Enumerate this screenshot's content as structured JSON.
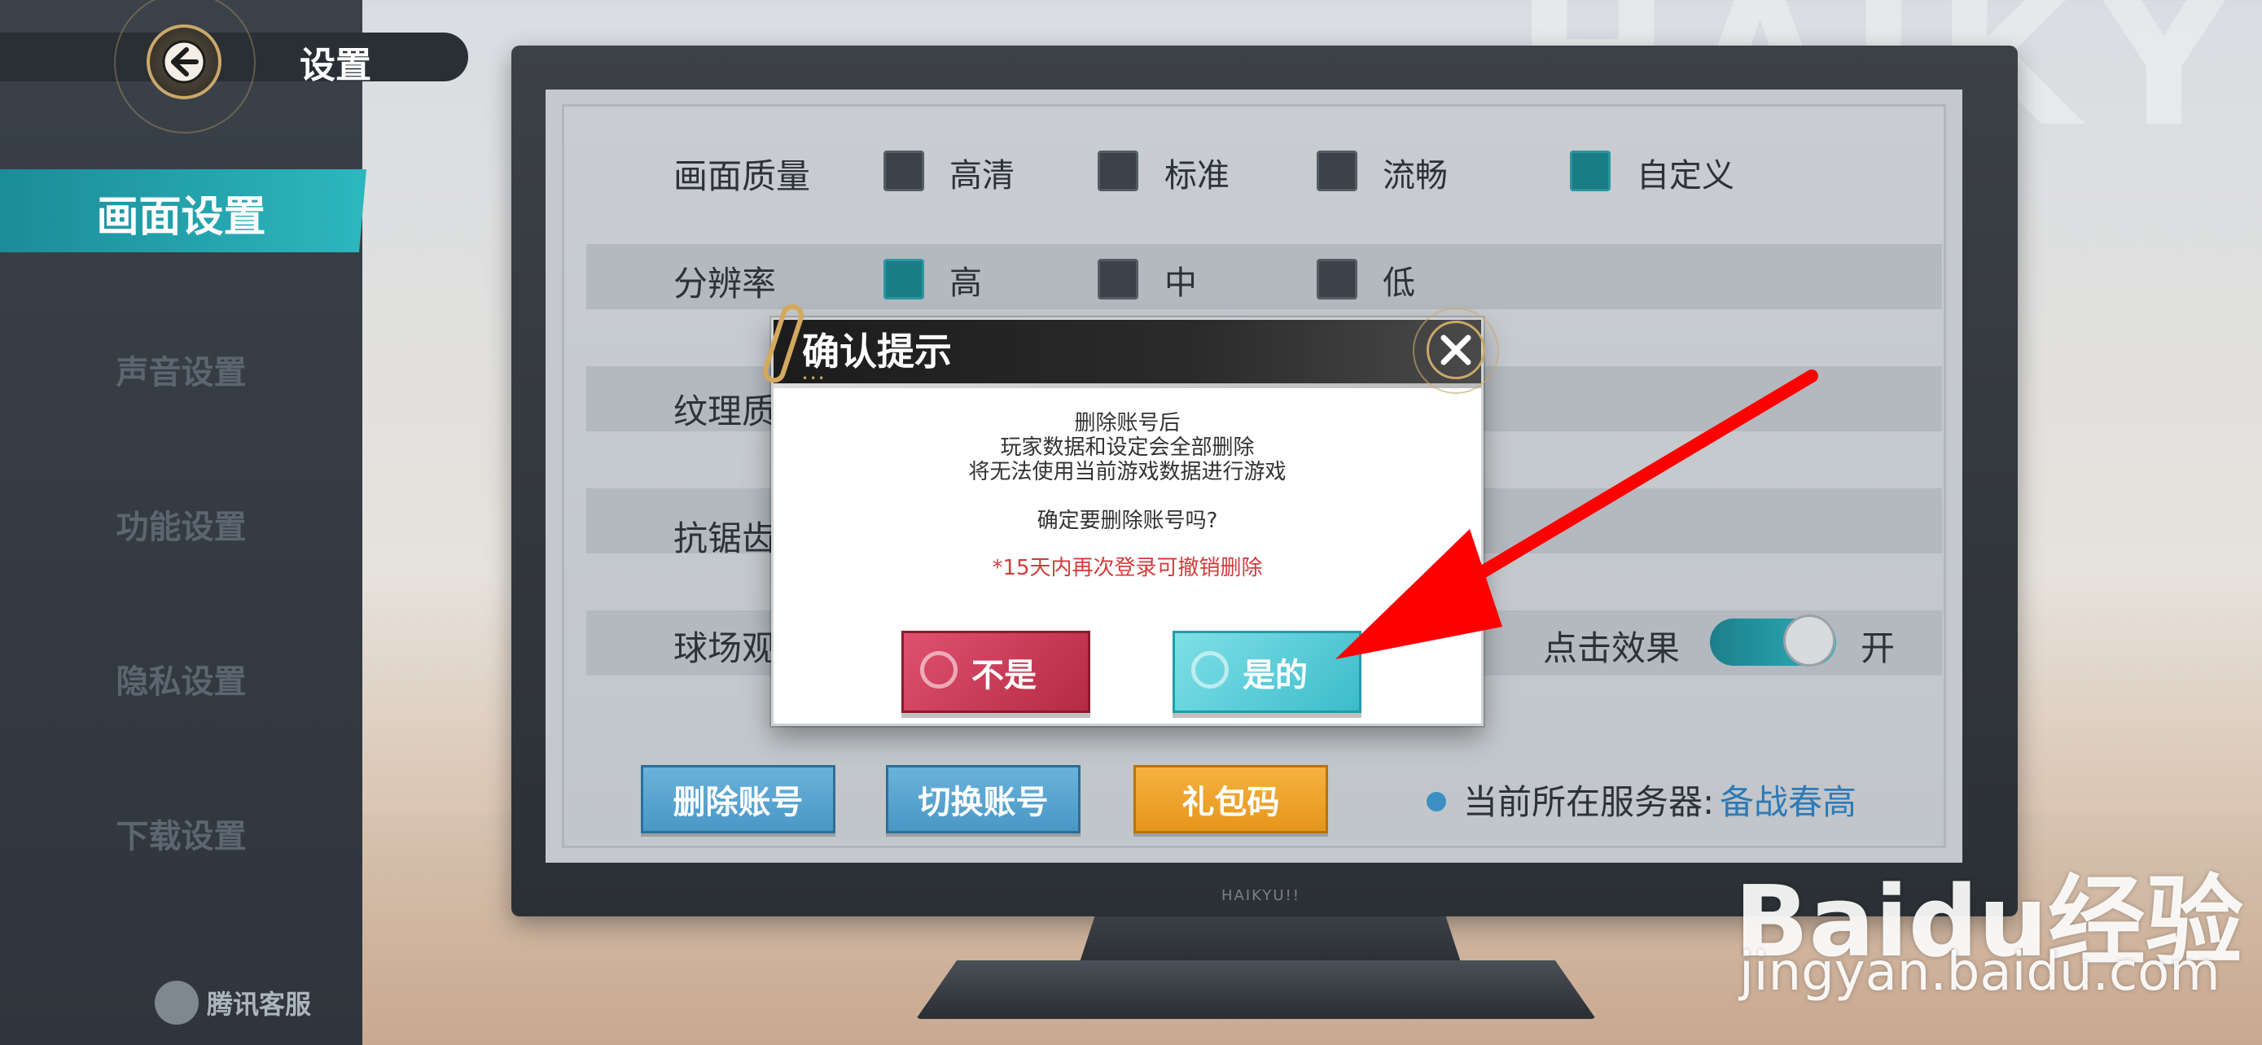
{
  "header": {
    "title": "设置"
  },
  "sidebar": {
    "items": [
      {
        "label": "画面设置",
        "active": true
      },
      {
        "label": "声音设置",
        "active": false
      },
      {
        "label": "功能设置",
        "active": false
      },
      {
        "label": "隐私设置",
        "active": false
      },
      {
        "label": "下载设置",
        "active": false
      }
    ],
    "customer_service": "腾讯客服"
  },
  "settings": {
    "quality": {
      "label": "画面质量",
      "options": [
        "高清",
        "标准",
        "流畅",
        "自定义"
      ],
      "selected": "自定义"
    },
    "resolution": {
      "label": "分辨率",
      "options": [
        "高",
        "中",
        "低"
      ],
      "selected": "高"
    },
    "texture": {
      "label": "纹理质"
    },
    "antialias": {
      "label": "抗锯齿"
    },
    "court": {
      "label": "球场观"
    },
    "click_effect": {
      "label": "点击效果",
      "state_label": "开",
      "on": true
    }
  },
  "actions": {
    "delete_account": "删除账号",
    "switch_account": "切换账号",
    "gift_code": "礼包码"
  },
  "server": {
    "label": "当前所在服务器:",
    "name": "备战春高"
  },
  "dialog": {
    "title": "确认提示",
    "lines": [
      "删除账号后",
      "玩家数据和设定会全部删除",
      "将无法使用当前游戏数据进行游戏"
    ],
    "question": "确定要删除账号吗?",
    "note": "*15天内再次登录可撤销删除",
    "no_label": "不是",
    "yes_label": "是的",
    "button_tag": "HAIKYU!!"
  },
  "monitor_brand": "HAIKYU!!",
  "watermark": {
    "brand": "Baidu经验",
    "url": "jingyan.baidu.com"
  },
  "colors": {
    "accent": "#2cb7bf",
    "danger": "#d23c3c",
    "arrow": "#ff0000"
  }
}
